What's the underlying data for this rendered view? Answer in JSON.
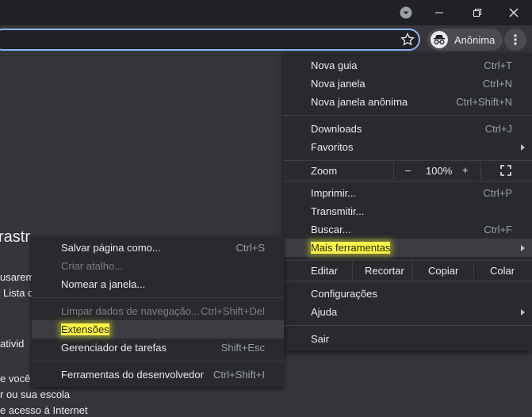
{
  "window": {
    "profile_label": "Anônima"
  },
  "page_text": [
    "rastr",
    "usarem",
    "Lista d",
    "ativid",
    "e você",
    "r ou sua escola",
    "e acesso à Internet"
  ],
  "menu": {
    "new_tab": {
      "label": "Nova guia",
      "shortcut": "Ctrl+T"
    },
    "new_window": {
      "label": "Nova janela",
      "shortcut": "Ctrl+N"
    },
    "new_incognito": {
      "label": "Nova janela anônima",
      "shortcut": "Ctrl+Shift+N"
    },
    "downloads": {
      "label": "Downloads",
      "shortcut": "Ctrl+J"
    },
    "bookmarks": {
      "label": "Favoritos"
    },
    "zoom": {
      "label": "Zoom",
      "minus": "–",
      "value": "100%",
      "plus": "+"
    },
    "print": {
      "label": "Imprimir...",
      "shortcut": "Ctrl+P"
    },
    "cast": {
      "label": "Transmitir..."
    },
    "find": {
      "label": "Buscar...",
      "shortcut": "Ctrl+F"
    },
    "more_tools": {
      "label": "Mais ferramentas"
    },
    "edit": {
      "label": "Editar",
      "cut": "Recortar",
      "copy": "Copiar",
      "paste": "Colar"
    },
    "settings": {
      "label": "Configurações"
    },
    "help": {
      "label": "Ajuda"
    },
    "exit": {
      "label": "Sair"
    }
  },
  "submenu": {
    "save_page": {
      "label": "Salvar página como...",
      "shortcut": "Ctrl+S"
    },
    "create_shortcut": {
      "label": "Criar atalho..."
    },
    "name_window": {
      "label": "Nomear a janela..."
    },
    "clear_data": {
      "label": "Limpar dados de navegação...",
      "shortcut": "Ctrl+Shift+Del"
    },
    "extensions": {
      "label": "Extensões"
    },
    "task_manager": {
      "label": "Gerenciador de tarefas",
      "shortcut": "Shift+Esc"
    },
    "dev_tools": {
      "label": "Ferramentas do desenvolvedor",
      "shortcut": "Ctrl+Shift+I"
    }
  }
}
